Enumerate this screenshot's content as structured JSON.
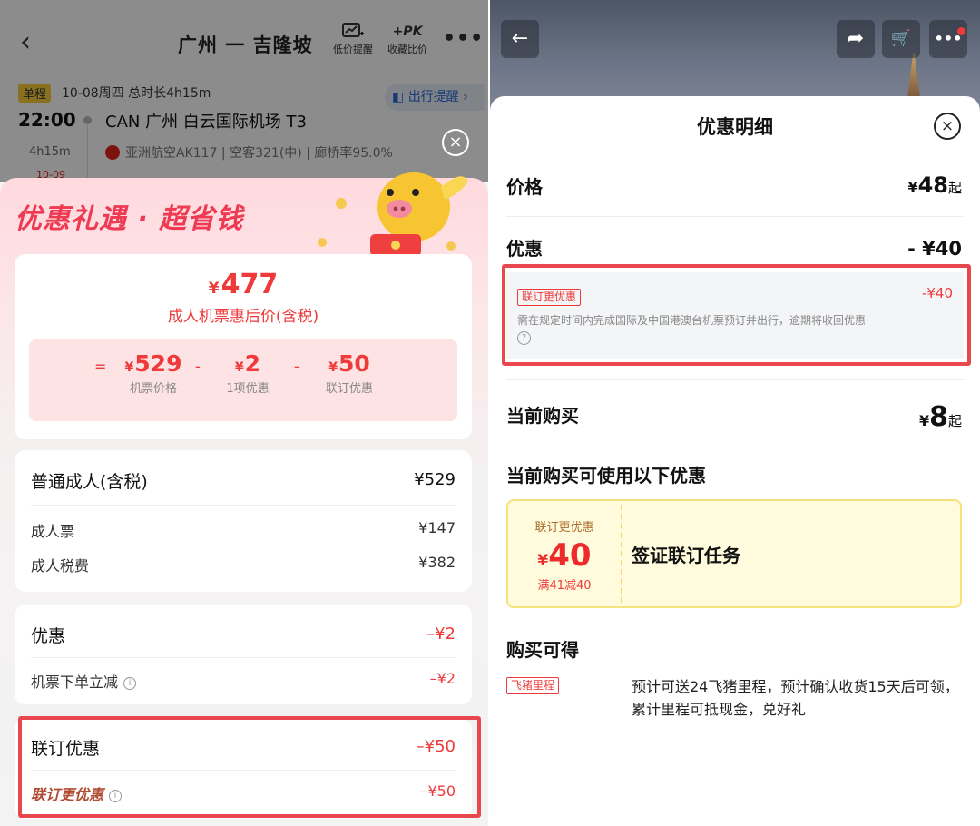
{
  "left": {
    "header": {
      "route_title": "广州 一 吉隆坡",
      "low_price_alert_label": "低价提醒",
      "compare_icon_label": "+PK",
      "compare_label": "收藏比价",
      "more_label": "•••"
    },
    "flight": {
      "oneway_tag": "单程",
      "date_info": "10-08周四  总时长4h15m",
      "remind_button": "出行提醒 ›",
      "dep_time": "22:00",
      "airport": "CAN 广州 白云国际机场 T3",
      "duration": "4h15m",
      "airline_info": "亚洲航空AK117 | 空客321(中) | 廊桥率95.0%",
      "arrival_date": "10-09"
    },
    "promo": {
      "title": "优惠礼遇 · 超省钱",
      "currency": "¥",
      "final_price": "477",
      "final_price_note": "成人机票惠后价(含税)",
      "formula": [
        {
          "op": "=",
          "value": "529",
          "label": "机票价格"
        },
        {
          "op": "-",
          "value": "2",
          "label": "1项优惠"
        },
        {
          "op": "-",
          "value": "50",
          "label": "联订优惠"
        }
      ]
    },
    "fare_card": {
      "title": "普通成人(含税)",
      "total": "¥529",
      "rows": [
        {
          "label": "成人票",
          "value": "¥147"
        },
        {
          "label": "成人税费",
          "value": "¥382"
        }
      ]
    },
    "discount_card": {
      "title": "优惠",
      "total": "–¥2",
      "row_label": "机票下单立减",
      "row_value": "–¥2"
    },
    "bundle_card": {
      "title": "联订优惠",
      "total": "–¥50",
      "row_label": "联订更优惠",
      "row_value": "–¥50"
    },
    "info_glyph": "i",
    "close_glyph": "×",
    "back_glyph": "‹"
  },
  "right": {
    "sheet_title": "优惠明细",
    "close_glyph": "×",
    "price_section": {
      "label": "价格",
      "currency": "¥",
      "value": "48",
      "suffix": "起"
    },
    "discount_section": {
      "label": "优惠",
      "value": "- ¥40",
      "detail_tag": "联订更优惠",
      "detail_amount": "-¥40",
      "detail_desc": "需在规定时间内完成国际及中国港澳台机票预订并出行，逾期将收回优惠",
      "help_glyph": "?"
    },
    "current_section": {
      "label": "当前购买",
      "currency": "¥",
      "value": "8",
      "suffix": "起"
    },
    "usable_section": {
      "title": "当前购买可使用以下优惠",
      "coupon": {
        "tag": "联订更优惠",
        "currency": "¥",
        "value": "40",
        "condition": "满41减40",
        "name": "签证联订任务"
      }
    },
    "rewards_section": {
      "title": "购买可得",
      "tag": "飞猪里程",
      "desc": "预计可送24飞猪里程，预计确认收货15天后可领，累计里程可抵现金，兑好礼"
    },
    "top_buttons": {
      "back_glyph": "←",
      "share_glyph": "➦",
      "cart_glyph": "🛒",
      "more_glyph": "•••"
    }
  },
  "colors": {
    "accent_red": "#ee3a3a",
    "highlight_border": "#e8474d",
    "promo_title": "#ee3a52",
    "coupon_bg": "#fffbdc",
    "oneway_tag_bg": "#f9cf3a"
  }
}
